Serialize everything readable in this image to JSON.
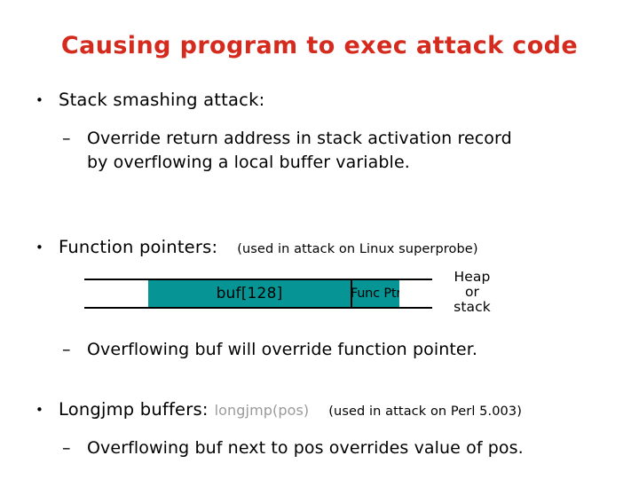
{
  "slide": {
    "title": "Causing program to exec attack code",
    "title_color": "#d52b1e",
    "background_color": "#ffffff"
  },
  "bullets": [
    {
      "mark": "•",
      "text": "Stack smashing attack:"
    },
    {
      "mark": "–",
      "line1": "Override return address in stack activation record",
      "line2": "by overflowing a local buffer variable."
    },
    {
      "mark": "•",
      "text": "Function pointers:",
      "note": "(used in attack on  Linux superprobe)"
    },
    {
      "mark": "–",
      "text": "Overflowing  buf  will override function pointer."
    },
    {
      "mark": "•",
      "text": "Longjmp buffers:",
      "code": "longjmp(pos)",
      "note": "(used in attack on  Perl 5.003)"
    },
    {
      "mark": "–",
      "text": "Overflowing buf next to pos overrides value of pos."
    }
  ],
  "diagram": {
    "segments": [
      {
        "name": "low-memory",
        "label": "",
        "fill": "#ffffff"
      },
      {
        "name": "buffer",
        "label": "buf[128]",
        "fill": "#079494"
      },
      {
        "name": "function-pointer",
        "label": "Func Ptr",
        "fill": "#079494"
      },
      {
        "name": "high-memory",
        "label": "",
        "fill": "#ffffff"
      }
    ],
    "side_label": {
      "line1": "Heap",
      "line2": "or",
      "line3": "stack"
    },
    "accent_color": "#079494"
  }
}
